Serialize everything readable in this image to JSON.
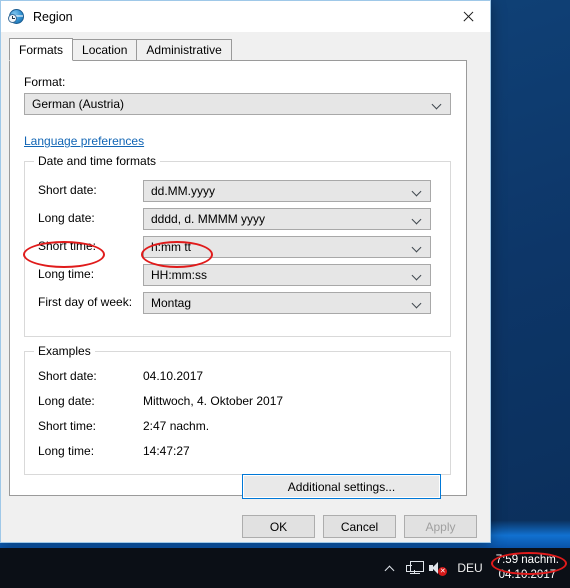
{
  "window": {
    "title": "Region",
    "icon": "region-globe-clock-icon",
    "close_label": "✕"
  },
  "tabs": [
    {
      "label": "Formats",
      "selected": true
    },
    {
      "label": "Location",
      "selected": false
    },
    {
      "label": "Administrative",
      "selected": false
    }
  ],
  "format_section": {
    "label": "Format:",
    "value": "German (Austria)",
    "link": "Language preferences"
  },
  "date_time_group": {
    "legend": "Date and time formats",
    "rows": [
      {
        "label": "Short date:",
        "value": "dd.MM.yyyy"
      },
      {
        "label": "Long date:",
        "value": "dddd, d. MMMM yyyy"
      },
      {
        "label": "Short time:",
        "value": "h:mm tt"
      },
      {
        "label": "Long time:",
        "value": "HH:mm:ss"
      },
      {
        "label": "First day of week:",
        "value": "Montag"
      }
    ]
  },
  "examples_group": {
    "legend": "Examples",
    "rows": [
      {
        "label": "Short date:",
        "value": "04.10.2017"
      },
      {
        "label": "Long date:",
        "value": "Mittwoch, 4. Oktober 2017"
      },
      {
        "label": "Short time:",
        "value": "2:47 nachm."
      },
      {
        "label": "Long time:",
        "value": "14:47:27"
      }
    ]
  },
  "buttons": {
    "additional_settings": "Additional settings...",
    "ok": "OK",
    "cancel": "Cancel",
    "apply": "Apply"
  },
  "taskbar": {
    "show_hidden_icons": "show-hidden-icons",
    "network_icon": "network-monitor-icon",
    "volume_icon": "speaker-muted-icon",
    "volume_mute_mark": "✕",
    "language": "DEU",
    "clock_time": "7:59 nachm.",
    "clock_date": "04.10.2017"
  },
  "annotations": {
    "accent_color": "#e01b1b",
    "marked": [
      "Short time: label",
      "h:mm tt value",
      "taskbar clock time"
    ]
  }
}
